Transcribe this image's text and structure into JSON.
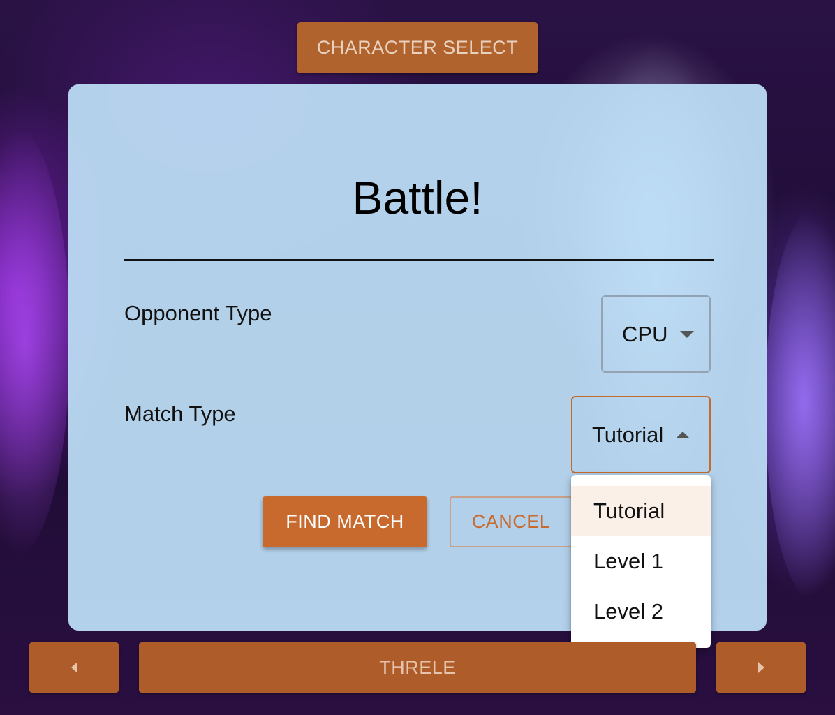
{
  "top_bar": {
    "character_select_label": "CHARACTER SELECT"
  },
  "dialog": {
    "title": "Battle!",
    "opponent_type": {
      "label": "Opponent Type",
      "value": "CPU"
    },
    "match_type": {
      "label": "Match Type",
      "value": "Tutorial",
      "expanded": true
    },
    "find_match_label": "FIND MATCH",
    "cancel_label": "CANCEL"
  },
  "match_type_menu": {
    "options": [
      "Tutorial",
      "Level 1",
      "Level 2"
    ],
    "selected": "Tutorial"
  },
  "bottom_bar": {
    "character_name": "THRELE",
    "prev_icon": "caret-left-icon",
    "next_icon": "caret-right-icon"
  },
  "colors": {
    "accent": "#c8692d",
    "panel": "#bee0f8"
  }
}
